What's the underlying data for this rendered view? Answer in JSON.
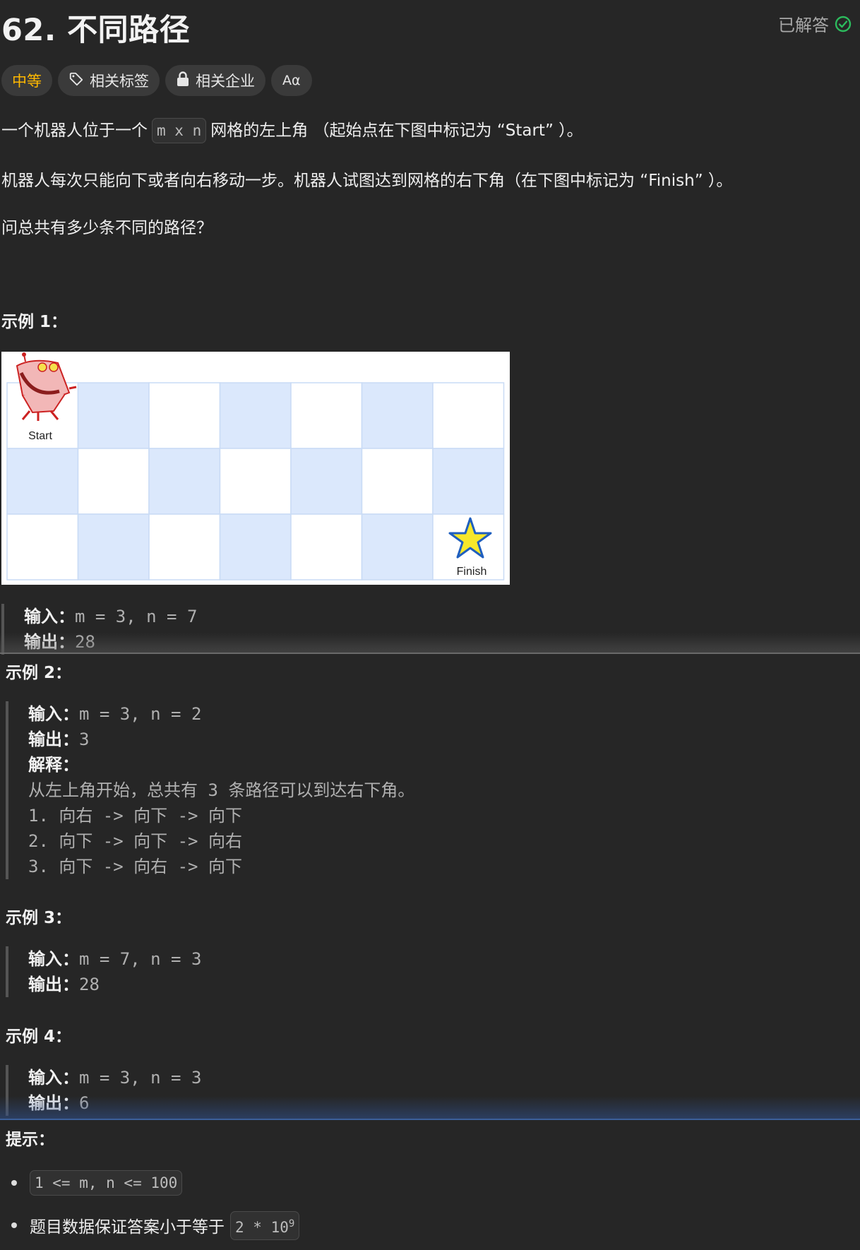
{
  "header": {
    "title": "62. 不同路径",
    "solved_label": "已解答"
  },
  "tags": {
    "difficulty": "中等",
    "related_tags": "相关标签",
    "related_companies": "相关企业",
    "font_toggle": "Aα"
  },
  "description": {
    "p1_before": "一个机器人位于一个",
    "p1_code": "m x n",
    "p1_after": "网格的左上角 （起始点在下图中标记为 “Start” ）。",
    "p2": "机器人每次只能向下或者向右移动一步。机器人试图达到网格的右下角（在下图中标记为 “Finish” ）。",
    "p3": "问总共有多少条不同的路径？"
  },
  "image": {
    "start_label": "Start",
    "finish_label": "Finish",
    "rows": 3,
    "cols": 7
  },
  "labels": {
    "input": "输入：",
    "output": "输出：",
    "explanation": "解释："
  },
  "examples": [
    {
      "heading": "示例 1：",
      "input": "m = 3, n = 7",
      "output": "28"
    },
    {
      "heading": "示例 2：",
      "input": "m = 3, n = 2",
      "output": "3",
      "explanation_lines": [
        "从左上角开始，总共有 3 条路径可以到达右下角。",
        "1. 向右 -> 向下 -> 向下",
        "2. 向下 -> 向下 -> 向右",
        "3. 向下 -> 向右 -> 向下"
      ]
    },
    {
      "heading": "示例 3：",
      "input": "m = 7, n = 3",
      "output": "28"
    },
    {
      "heading": "示例 4：",
      "input": "m = 3, n = 3",
      "output": "6"
    }
  ],
  "hints": {
    "heading": "提示：",
    "h1": "1 <= m, n <= 100",
    "h2_text": "题目数据保证答案小于等于",
    "h2_code_base": "2 * 10",
    "h2_code_exp": "9"
  },
  "colors": {
    "background": "#262626",
    "difficulty": "#ffb800",
    "solved_check": "#2cbb5d",
    "grid_shade": "#dbe8fc"
  }
}
